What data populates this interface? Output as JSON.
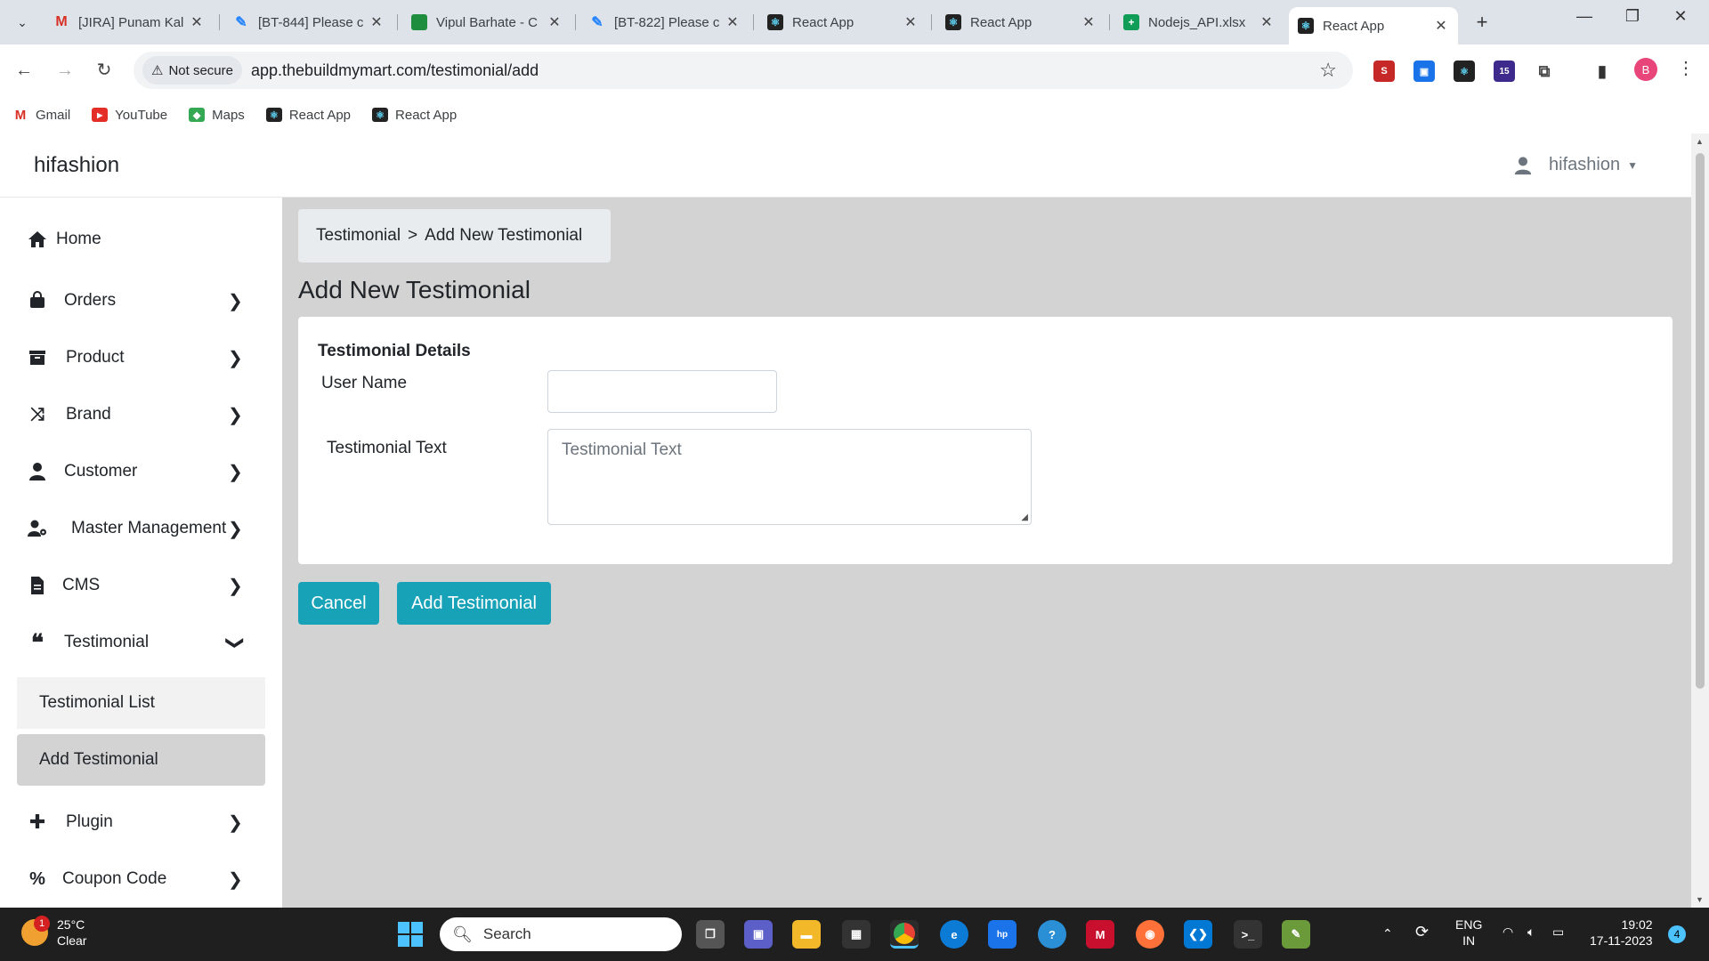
{
  "browser": {
    "tabs": [
      {
        "title": "[JIRA] Punam Kal",
        "favicon": "gmail-icon",
        "active": false
      },
      {
        "title": "[BT-844] Please c",
        "favicon": "jira-icon",
        "active": false
      },
      {
        "title": "Vipul Barhate - C",
        "favicon": "chat-icon",
        "active": false
      },
      {
        "title": "[BT-822] Please c",
        "favicon": "jira-icon",
        "active": false
      },
      {
        "title": "React App",
        "favicon": "react-icon",
        "active": false
      },
      {
        "title": "React App",
        "favicon": "react-icon",
        "active": false
      },
      {
        "title": "Nodejs_API.xlsx",
        "favicon": "sheets-icon",
        "active": false
      },
      {
        "title": "React App",
        "favicon": "react-icon",
        "active": true
      }
    ],
    "security_label": "Not secure",
    "url": "app.thebuildmymart.com/testimonial/add",
    "extension_badge": "15",
    "profile_initial": "B",
    "bookmarks": [
      {
        "label": "Gmail",
        "icon": "gmail-icon"
      },
      {
        "label": "YouTube",
        "icon": "youtube-icon"
      },
      {
        "label": "Maps",
        "icon": "maps-icon"
      },
      {
        "label": "React App",
        "icon": "react-icon"
      },
      {
        "label": "React App",
        "icon": "react-icon"
      }
    ]
  },
  "header": {
    "brand": "hifashion",
    "user": "hifashion"
  },
  "sidebar": {
    "items": [
      {
        "label": "Home",
        "icon": "home-icon"
      },
      {
        "label": "Orders",
        "icon": "bag-icon"
      },
      {
        "label": "Product",
        "icon": "box-icon"
      },
      {
        "label": "Brand",
        "icon": "shuffle-icon"
      },
      {
        "label": "Customer",
        "icon": "user-icon"
      },
      {
        "label": "Master Management",
        "icon": "user-gear-icon"
      },
      {
        "label": "CMS",
        "icon": "file-icon"
      },
      {
        "label": "Testimonial",
        "icon": "quote-icon"
      },
      {
        "label": "Plugin",
        "icon": "puzzle-icon"
      },
      {
        "label": "Coupon Code",
        "icon": "percent-icon"
      }
    ],
    "testimonial_sub": [
      {
        "label": "Testimonial List"
      },
      {
        "label": "Add Testimonial"
      }
    ]
  },
  "main": {
    "breadcrumb": {
      "parent": "Testimonial",
      "separator": ">",
      "current": "Add New Testimonial"
    },
    "title": "Add New Testimonial",
    "form": {
      "section_title": "Testimonial Details",
      "user_name_label": "User Name",
      "user_name_value": "",
      "testimonial_text_label": "Testimonial Text",
      "testimonial_text_placeholder": "Testimonial Text"
    },
    "cancel_label": "Cancel",
    "submit_label": "Add Testimonial"
  },
  "taskbar": {
    "weather_temp": "25°C",
    "weather_desc": "Clear",
    "weather_badge": "1",
    "search_label": "Search",
    "lang_1": "ENG",
    "lang_2": "IN",
    "time": "19:02",
    "date": "17-11-2023",
    "notification_count": "4"
  },
  "colors": {
    "accent": "#17a2b8",
    "main_bg": "#d3d3d3",
    "breadcrumb_bg": "#e9ecef",
    "active_sub_bg": "#d3d3d3"
  }
}
